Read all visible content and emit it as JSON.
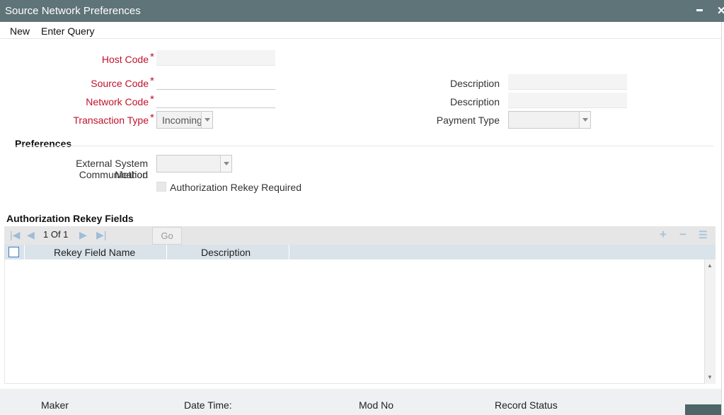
{
  "window": {
    "title": "Source Network Preferences",
    "minimize_icon": "minimize-icon",
    "close_icon": "close-icon",
    "close_glyph": "✕"
  },
  "menu": {
    "new": "New",
    "enter_query": "Enter Query"
  },
  "form": {
    "host_code": {
      "label": "Host Code",
      "value": ""
    },
    "source_code": {
      "label": "Source Code",
      "value": ""
    },
    "network_code": {
      "label": "Network Code",
      "value": ""
    },
    "transaction_type": {
      "label": "Transaction Type",
      "value": "Incoming"
    },
    "required_mark": "*",
    "source_description": {
      "label": "Description",
      "value": ""
    },
    "network_description": {
      "label": "Description",
      "value": ""
    },
    "payment_type": {
      "label": "Payment Type",
      "value": ""
    }
  },
  "preferences": {
    "heading": "Preferences",
    "ext_comm_label_line1": "External System Communication",
    "ext_comm_label_line2": "Method",
    "ext_comm_value": "",
    "auth_rekey_label": "Authorization Rekey Required"
  },
  "rekey_grid": {
    "heading": "Authorization Rekey Fields",
    "pager": "1 Of 1",
    "go_label": "Go",
    "columns": [
      "Rekey Field Name",
      "Description"
    ],
    "rows": []
  },
  "footer": {
    "maker": "Maker",
    "date_time": "Date Time:",
    "mod_no": "Mod No",
    "record_status": "Record Status"
  },
  "colors": {
    "titlebar": "#5f7478",
    "required": "#c0112b",
    "grid_header": "#dae3ea",
    "toolbar_icon": "#a6c4de"
  }
}
